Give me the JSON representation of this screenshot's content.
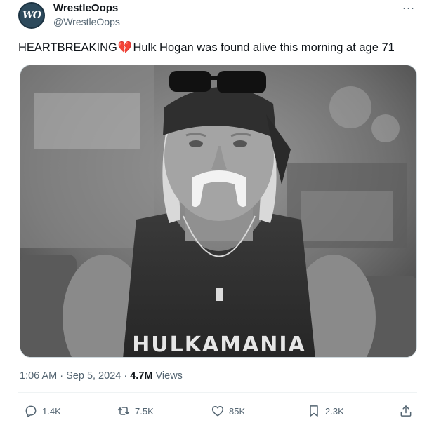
{
  "author": {
    "display_name": "WrestleOops",
    "handle": "@WrestleOops_",
    "avatar_text": "WO"
  },
  "more_icon": "more-horizontal-icon",
  "tweet": {
    "text_before": "HEARTBREAKING",
    "emoji": "💔",
    "text_after": "Hulk Hogan was found alive this morning at age 71",
    "time": "1:06 AM",
    "separator": "·",
    "date": "Sep 5, 2024",
    "views_count": "4.7M",
    "views_label": "Views",
    "image_shirt_text": "HULKAMANIA"
  },
  "actions": {
    "replies": "1.4K",
    "retweets": "7.5K",
    "likes": "85K",
    "bookmarks": "2.3K"
  },
  "colors": {
    "text": "#0f1419",
    "secondary": "#536471",
    "heart": "#dd2e44",
    "border": "#cfd9de"
  }
}
